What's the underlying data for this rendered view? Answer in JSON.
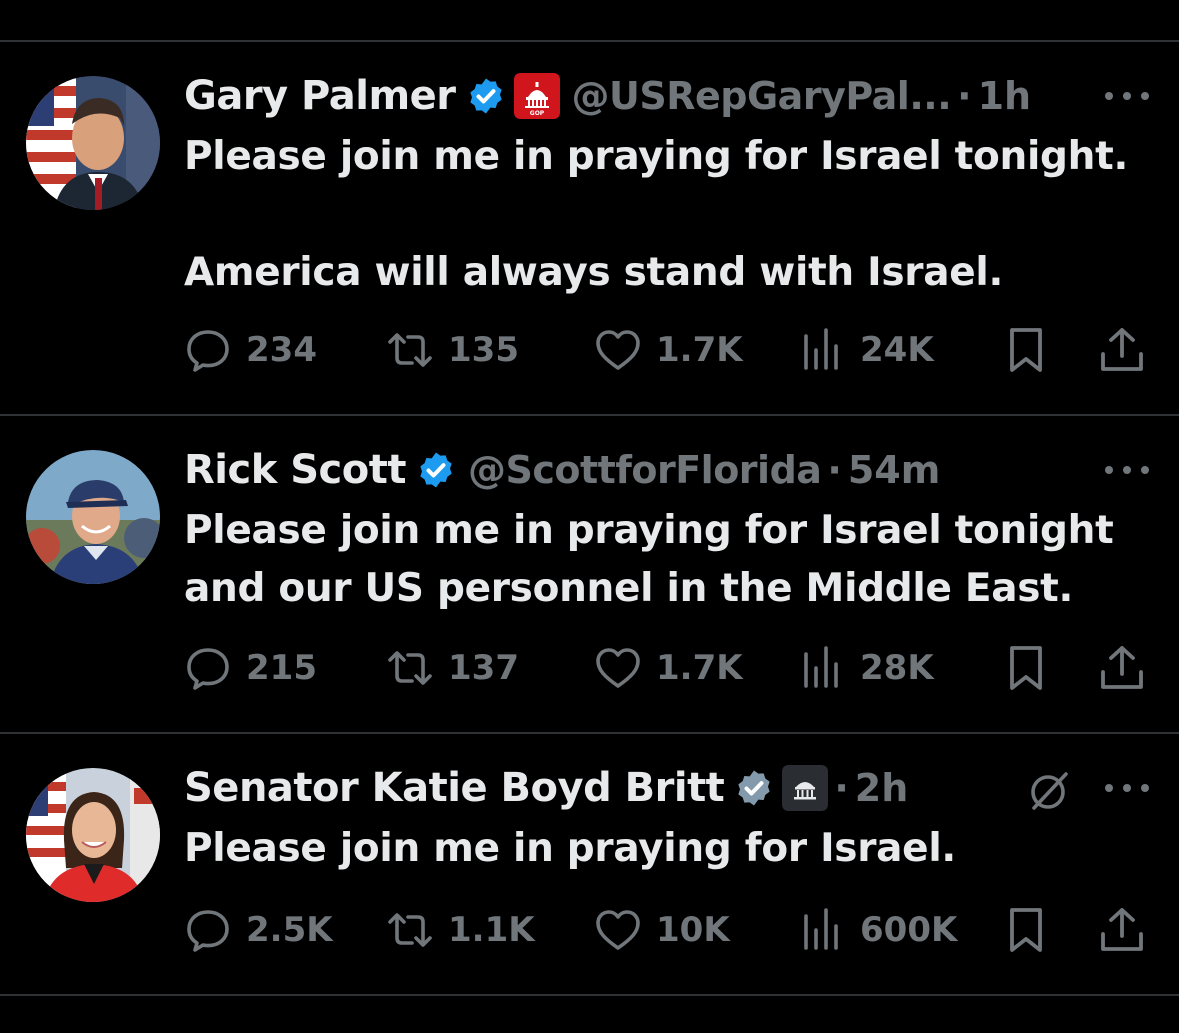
{
  "tweets": [
    {
      "name": "Gary Palmer",
      "handle": "@USRepGaryPal...",
      "time": "1h",
      "lines": [
        "Please join me in praying for Israel tonight.",
        "America will always stand with Israel."
      ],
      "replies": "234",
      "reposts": "135",
      "likes": "1.7K",
      "views": "24K",
      "affiliation_icon": "capitol-gop-badge-icon",
      "affiliation_text": "GOP"
    },
    {
      "name": "Rick Scott",
      "handle": "@ScottforFlorida",
      "time": "54m",
      "lines": [
        "Please join me in praying for Israel tonight",
        "and our US personnel in the Middle East."
      ],
      "replies": "215",
      "reposts": "137",
      "likes": "1.7K",
      "views": "28K"
    },
    {
      "name": "Senator Katie Boyd Britt",
      "handle": "",
      "time": "2h",
      "lines": [
        "Please join me in praying for Israel."
      ],
      "replies": "2.5K",
      "reposts": "1.1K",
      "likes": "10K",
      "views": "600K",
      "affiliation_icon": "government-building-icon"
    }
  ],
  "colors": {
    "background": "#000000",
    "text": "#e7e9ea",
    "muted": "#71767b",
    "verified_blue": "#1d9bf0",
    "divider": "#2f3336",
    "gop_red": "#d1151d"
  }
}
